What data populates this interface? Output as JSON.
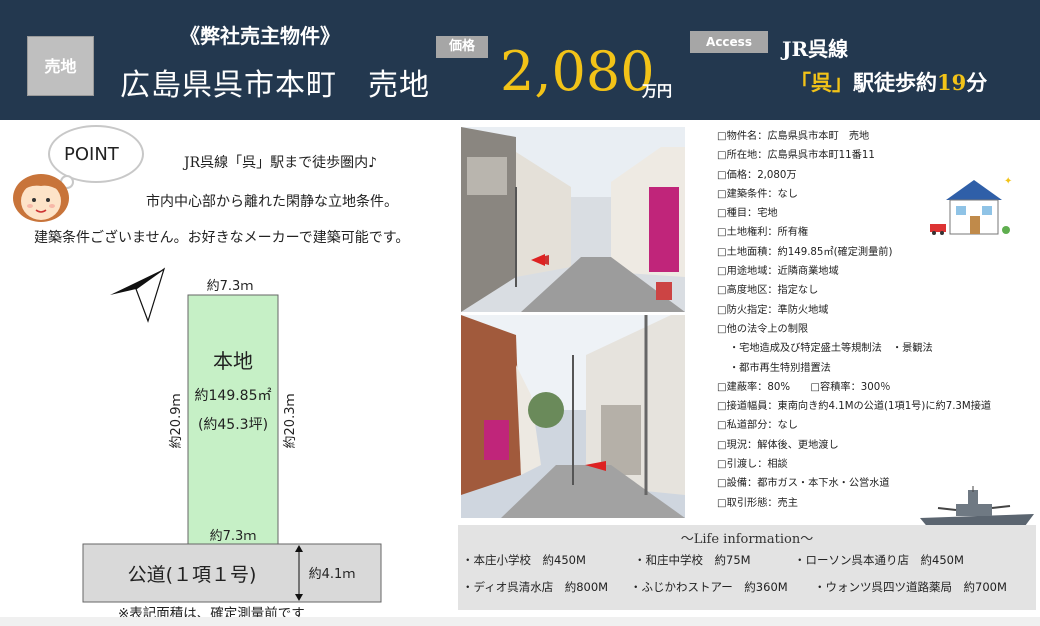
{
  "header": {
    "badge_sale": "売地",
    "subtitle": "《弊社売主物件》",
    "title": "広島県呉市本町　売地",
    "price_badge": "価格",
    "price": "2,080",
    "price_unit": "万円",
    "access_badge": "Access",
    "line": "JR呉線",
    "station_open": "「呉」",
    "station_mid": "駅徒歩約",
    "minutes": "19",
    "minutes_unit": "分"
  },
  "point": {
    "label": "POINT",
    "lines": [
      "JR呉線「呉」駅まで徒歩圏内♪",
      "市内中心部から離れた閑静な立地条件。",
      "建築条件ございません。お好きなメーカーで建築可能です。"
    ]
  },
  "plot": {
    "top_width": "約7.3ｍ",
    "name": "本地",
    "area_sqm": "約149.85㎡",
    "area_tsubo": "(約45.3坪)",
    "left_depth": "約20.9ｍ",
    "right_depth": "約20.3ｍ",
    "bottom_width": "約7.3ｍ",
    "road_label": "公道(１項１号)",
    "road_width": "約4.1ｍ",
    "note": "※表記面積は、確定測量前です"
  },
  "details": [
    "□物件名：広島県呉市本町　売地",
    "□所在地：広島県呉市本町11番11",
    "□価格：2,080万",
    "□建築条件：なし",
    "□種目：宅地",
    "□土地権利：所有権",
    "□土地面積：約149.85㎡(確定測量前)",
    "□用途地域：近隣商業地域",
    "□高度地区：指定なし",
    "□防火指定：準防火地域",
    "□他の法令上の制限",
    "・宅地造成及び特定盛土等規制法　・景観法",
    "・都市再生特別措置法",
    "□建蔽率：80%　　□容積率：300％",
    "□接道幅員：東南向き約4.1Mの公道(1項1号)に約7.3M接道",
    "□私道部分：なし",
    "□現況：解体後、更地渡し",
    "□引渡し：相談",
    "□設備：都市ガス・本下水・公営水道",
    "□取引形態：売主"
  ],
  "life": {
    "title": "～Life information～",
    "items": [
      "・本庄小学校　約450M",
      "・和庄中学校　約75M",
      "・ローソン呉本通り店　約450M",
      "・ディオ呉清水店　約800M",
      "・ふじかわストアー　約360M",
      "・ウォンツ呉四ツ道路薬局　約700M"
    ]
  },
  "colors": {
    "header_bg": "#23384f",
    "price": "#f2c318",
    "plot_fill": "#c6f0c6",
    "road_fill": "#d9d9d9",
    "life_bg": "#e3e3e3"
  }
}
